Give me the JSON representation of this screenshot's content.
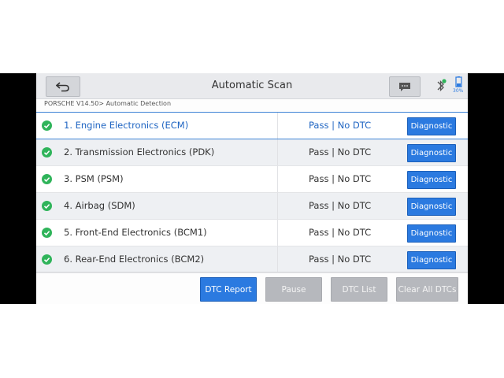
{
  "header": {
    "title": "Automatic Scan",
    "battery_text": "30%"
  },
  "breadcrumb": "PORSCHE V14.50> Automatic Detection",
  "systems": [
    {
      "name": "1. Engine Electronics (ECM)",
      "status": "Pass | No DTC",
      "action": "Diagnostic"
    },
    {
      "name": "2. Transmission Electronics (PDK)",
      "status": "Pass | No DTC",
      "action": "Diagnostic"
    },
    {
      "name": "3. PSM (PSM)",
      "status": "Pass | No DTC",
      "action": "Diagnostic"
    },
    {
      "name": "4. Airbag (SDM)",
      "status": "Pass | No DTC",
      "action": "Diagnostic"
    },
    {
      "name": "5. Front-End Electronics (BCM1)",
      "status": "Pass | No DTC",
      "action": "Diagnostic"
    },
    {
      "name": "6. Rear-End Electronics (BCM2)",
      "status": "Pass | No DTC",
      "action": "Diagnostic"
    }
  ],
  "footer": {
    "dtc_report": "DTC Report",
    "pause": "Pause",
    "dtc_list": "DTC List",
    "clear_all": "Clear All DTCs"
  },
  "colors": {
    "accent": "#2b7ae0",
    "check": "#2fb45a",
    "disabled": "#b6b8bd"
  }
}
